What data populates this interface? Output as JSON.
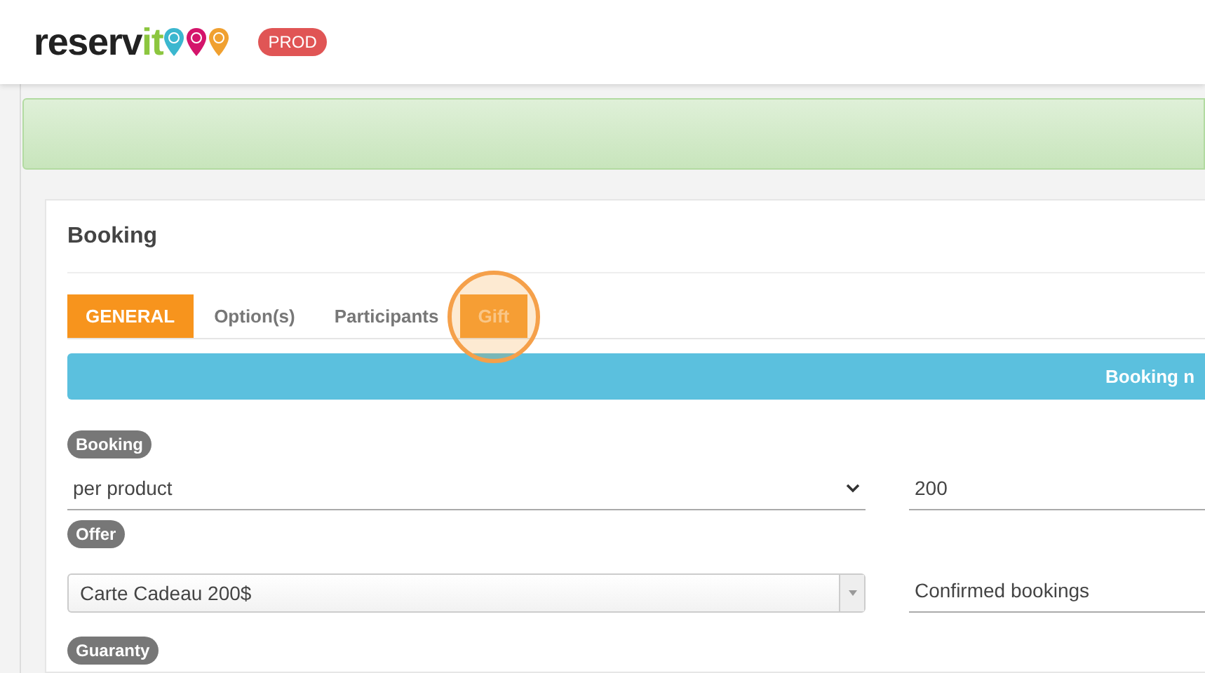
{
  "header": {
    "logo": {
      "text": "reserv",
      "accent": "it"
    },
    "env_badge": "PROD"
  },
  "card": {
    "title": "Booking",
    "tabs": [
      {
        "label": "GENERAL",
        "selected": true,
        "highlighted": false
      },
      {
        "label": "Option(s)",
        "selected": false,
        "highlighted": false
      },
      {
        "label": "Participants",
        "selected": false,
        "highlighted": false
      },
      {
        "label": "Gift",
        "selected": false,
        "highlighted": true
      }
    ],
    "info_bar": "Booking n",
    "sections": [
      {
        "label": "Booking",
        "left": {
          "kind": "native-select",
          "value": "per product"
        },
        "right": {
          "value": "200"
        }
      },
      {
        "label": "Offer",
        "left": {
          "kind": "combo-select",
          "value": "Carte Cadeau 200$"
        },
        "right": {
          "value": "Confirmed bookings"
        }
      },
      {
        "label": "Guaranty"
      }
    ]
  }
}
